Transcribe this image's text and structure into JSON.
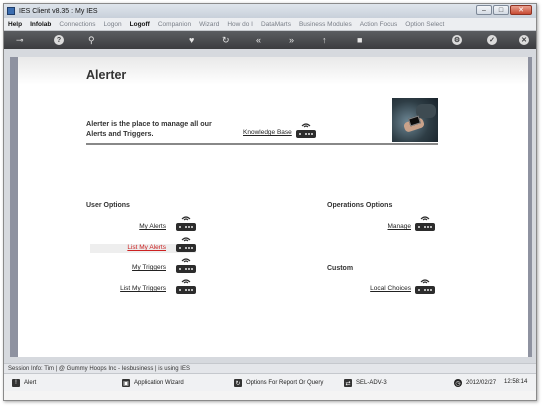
{
  "window": {
    "title": "IES Client v8.35 : My IES",
    "controls": {
      "minimize": "–",
      "maximize": "□",
      "close": "✕"
    }
  },
  "menu": [
    {
      "label": "Help",
      "active": true
    },
    {
      "label": "Infolab",
      "active": true
    },
    {
      "label": "Connections",
      "active": false
    },
    {
      "label": "Logon",
      "active": false
    },
    {
      "label": "Logoff",
      "active": true
    },
    {
      "label": "Companion",
      "active": false
    },
    {
      "label": "Wizard",
      "active": false
    },
    {
      "label": "How do I",
      "active": false
    },
    {
      "label": "DataMarts",
      "active": false
    },
    {
      "label": "Business Modules",
      "active": false
    },
    {
      "label": "Action Focus",
      "active": false
    },
    {
      "label": "Option Select",
      "active": false
    }
  ],
  "toolbar": {
    "icons": [
      "key-icon",
      "help-icon",
      "search-icon",
      "favorite-icon",
      "refresh-icon",
      "back-icon",
      "forward-icon",
      "upload-icon",
      "stop-icon",
      "settings-icon",
      "ok-icon",
      "close-icon"
    ],
    "glyphs": {
      "key": "⊸",
      "help": "?",
      "search": "⚲",
      "favorite": "♥",
      "refresh": "↻",
      "back": "«",
      "forward": "»",
      "upload": "↑",
      "stop": "■",
      "settings": "⚙",
      "ok": "✓",
      "close": "✕"
    }
  },
  "page": {
    "title": "Alerter",
    "intro": "Alerter is the place to manage all our Alerts and Triggers.",
    "knowledge_base": "Knowledge Base"
  },
  "user_options": {
    "title": "User Options",
    "items": [
      {
        "label": "My Alerts",
        "highlighted": false
      },
      {
        "label": "List My Alerts",
        "highlighted": true
      },
      {
        "label": "My Triggers",
        "highlighted": false
      },
      {
        "label": "List My Triggers",
        "highlighted": false
      }
    ]
  },
  "operations_options": {
    "title": "Operations Options",
    "items": [
      {
        "label": "Manage"
      }
    ]
  },
  "custom": {
    "title": "Custom",
    "items": [
      {
        "label": "Local Choices"
      }
    ]
  },
  "status": {
    "session": "Session Info: Tim | @ Gummy Hoops Inc  - Iesbusiness | is using IES"
  },
  "taskbar": {
    "alert": "Alert",
    "app_wizard": "Application Wizard",
    "options_report": "Options For Report Or Query",
    "server": "SEL-ADV-3",
    "date": "2012/02/27",
    "time": "12:58:14"
  },
  "colors": {
    "accent_link_active": "#cc2222",
    "toolbar_bg": "#3b3c3f",
    "side_panel": "#8e92a0"
  }
}
